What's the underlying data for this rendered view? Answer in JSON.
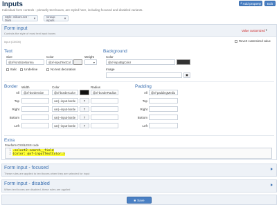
{
  "page": {
    "title": "Inputs",
    "description": "Individual form controls - primarily text boxes, are styled here, including focused and disabled variants.",
    "add_property": "Add property",
    "edit": "Edit",
    "style_selector": "Style: Silcom.net - Dark",
    "group_selector": "Group: inputs"
  },
  "panel": {
    "title": "Form input",
    "subtitle": "Controls the style of most text input boxes",
    "value_status": "Value customized",
    "input_id": "input (C0000)",
    "revert_label": "Revert customized value"
  },
  "text": {
    "heading": "Text",
    "size_label": "Size",
    "color_label": "Color",
    "weight_label": "Weight",
    "size_value": "@xf-fontSizeNorma",
    "color_value": "@xf-inputTextCol",
    "italic": "Italic",
    "underline": "Underline",
    "no_decoration": "No text decoration"
  },
  "background": {
    "heading": "Background",
    "color_label": "Color",
    "color_value": "@xf-inputBgColor",
    "image_label": "Image"
  },
  "border": {
    "heading": "Border",
    "width_label": "Width",
    "color_label": "Color",
    "radius_label": "Radius",
    "rows": [
      {
        "label": "All",
        "width": "@xf-borderSize",
        "color": "@xf-borderColor",
        "radius": "@xf-borderRadius"
      },
      {
        "label": "Top",
        "width": "",
        "color": "var(--input-borde",
        "radius": ""
      },
      {
        "label": "Right",
        "width": "",
        "color": "var(--input-borde",
        "radius": ""
      },
      {
        "label": "Bottom",
        "width": "",
        "color": "var(--input-borde",
        "radius": ""
      },
      {
        "label": "Left",
        "width": "",
        "color": "var(--input-borde",
        "radius": ""
      }
    ],
    "q": "?"
  },
  "padding": {
    "heading": "Padding",
    "rows": [
      {
        "label": "All",
        "value": "@xf-paddingMediu"
      },
      {
        "label": "Top",
        "value": ""
      },
      {
        "label": "Right",
        "value": ""
      },
      {
        "label": "Bottom",
        "value": ""
      },
      {
        "label": "Left",
        "value": ""
      }
    ]
  },
  "extra": {
    "heading": "Extra",
    "css_label": "Freeform CSS/LESS code",
    "lines": [
      {
        "n": "1",
        "code": ".select2-search__field"
      },
      {
        "n": "2",
        "code": "{color: @xf-inputTextColor;}"
      }
    ]
  },
  "focused": {
    "title": "Form input - focused",
    "subtitle": "These rules are applied to text boxes when they are selected for input"
  },
  "disabled": {
    "title": "Form input - disabled",
    "subtitle": "When text boxes are disabled, these rules are applied"
  },
  "save": "Save",
  "colors": {
    "accent": "#3a6fb0",
    "primary_button": "#4a80c4",
    "status": "#cc2222"
  }
}
